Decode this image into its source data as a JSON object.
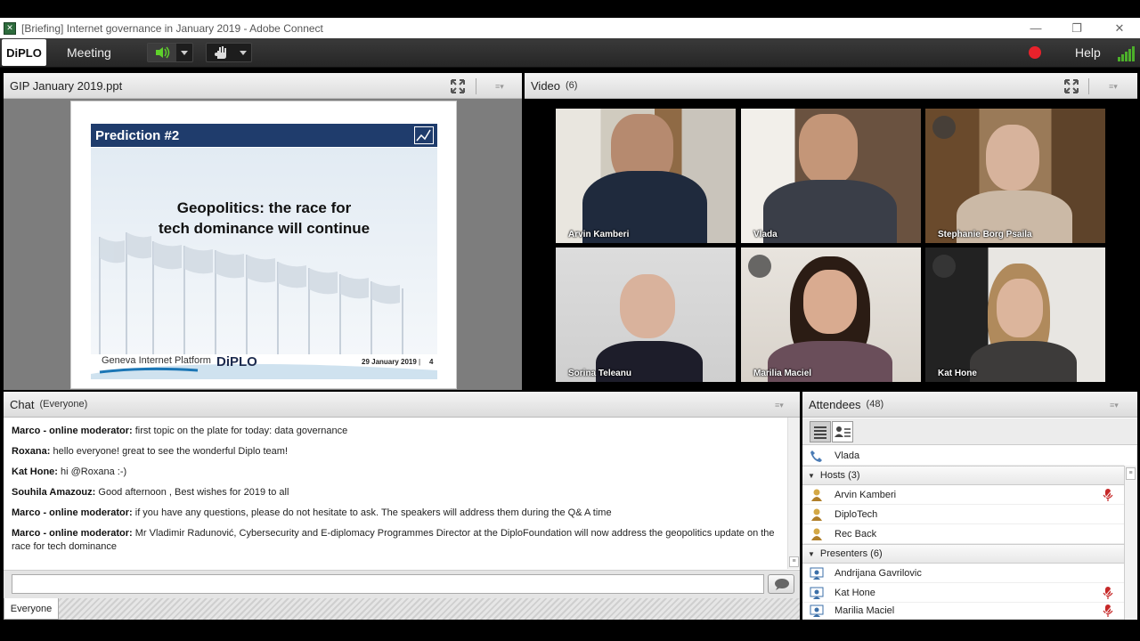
{
  "window": {
    "title": "[Briefing] Internet governance in January 2019 - Adobe Connect"
  },
  "menubar": {
    "logo": "DiPLO",
    "meeting": "Meeting",
    "help": "Help"
  },
  "share_pod": {
    "title": "GIP January 2019.ppt",
    "slide": {
      "header": "Prediction #2",
      "headline_line1": "Geopolitics: the race for",
      "headline_line2": "tech dominance will continue",
      "footer_org": "Geneva Internet Platform",
      "footer_logo": "DiPLO",
      "footer_date": "29 January 2019",
      "footer_sep": "|",
      "footer_page": "4"
    }
  },
  "video_pod": {
    "title": "Video",
    "count": "(6)",
    "tiles": [
      {
        "name": "Arvin Kamberi"
      },
      {
        "name": "Vlada"
      },
      {
        "name": "Stephanie Borg Psaila"
      },
      {
        "name": "Sorina Teleanu"
      },
      {
        "name": "Marilia Maciel"
      },
      {
        "name": "Kat Hone"
      }
    ]
  },
  "chat_pod": {
    "title": "Chat",
    "scope": "(Everyone)",
    "messages": [
      {
        "author": "Marco - online moderator:",
        "text": "first topic on the plate for today: data governance"
      },
      {
        "author": "Roxana:",
        "text": "hello everyone! great to see the wonderful Diplo team!"
      },
      {
        "author": "Kat Hone:",
        "text": "hi @Roxana :-)"
      },
      {
        "author": "Souhila Amazouz:",
        "text": "Good afternoon , Best wishes for 2019 to all"
      },
      {
        "author": "Marco - online moderator:",
        "text": "if you have any questions, please do not hesitate to ask. The speakers will address them during the Q& A time"
      },
      {
        "author": "Marco - online moderator:",
        "text": "Mr Vladimir Radunović, Cybersecurity and E-diplomacy Programmes Director at the DiploFoundation will now address the geopolitics update on the race for tech dominance"
      }
    ],
    "tab": "Everyone"
  },
  "attendees_pod": {
    "title": "Attendees",
    "count": "(48)",
    "self": "Vlada",
    "groups": [
      {
        "label": "Hosts (3)",
        "members": [
          "Arvin Kamberi",
          "DiploTech",
          "Rec Back"
        ]
      },
      {
        "label": "Presenters (6)",
        "members": [
          "Andrijana Gavrilovic",
          "Kat Hone",
          "Marilia Maciel"
        ]
      }
    ]
  },
  "colors": {
    "slide_header": "#1f3c6c",
    "record": "#e8222b",
    "signal": "#4caf2a"
  }
}
